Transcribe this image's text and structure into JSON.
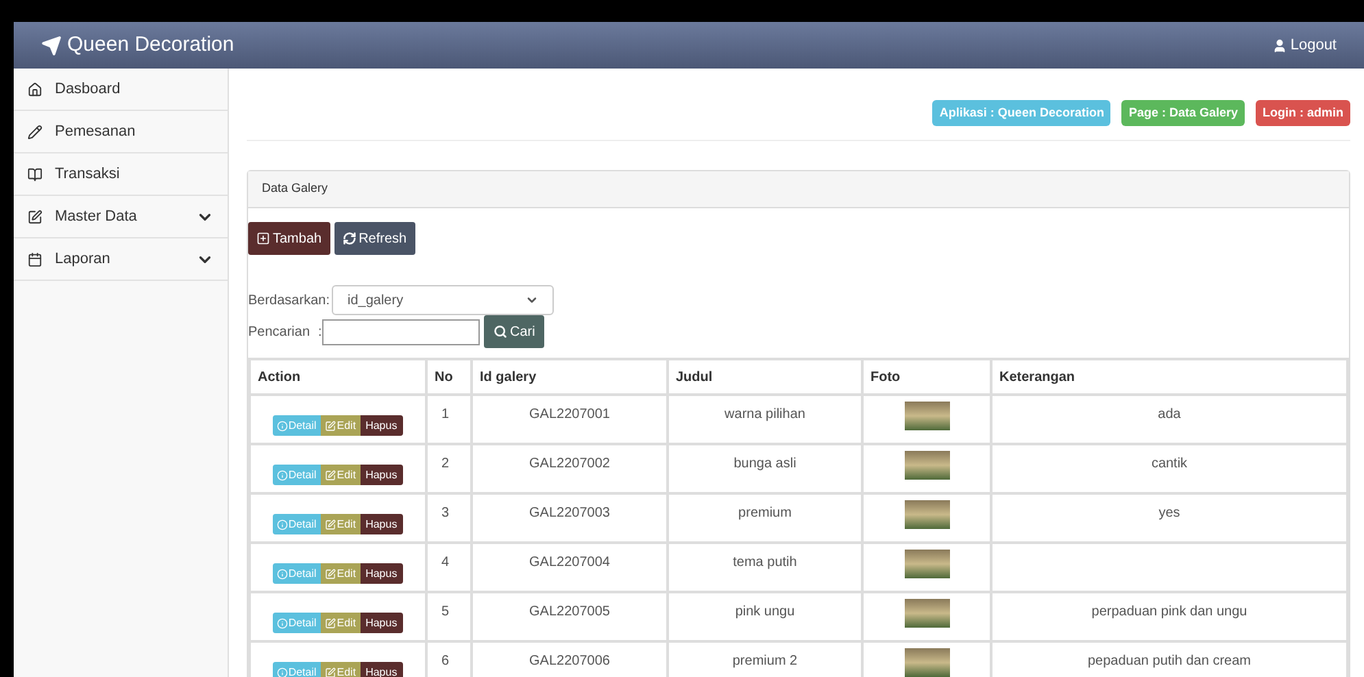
{
  "header": {
    "brand": "Queen Decoration",
    "logout": "Logout"
  },
  "sidebar": {
    "items": [
      {
        "label": "Dasboard",
        "kind": "home",
        "expandable": false
      },
      {
        "label": "Pemesanan",
        "kind": "pencil",
        "expandable": false
      },
      {
        "label": "Transaksi",
        "kind": "book",
        "expandable": false
      },
      {
        "label": "Master Data",
        "kind": "edit",
        "expandable": true
      },
      {
        "label": "Laporan",
        "kind": "calendar",
        "expandable": true
      }
    ]
  },
  "badges": [
    {
      "text": "Aplikasi : Queen Decoration",
      "color": "#5bc0de"
    },
    {
      "text": "Page : Data Galery",
      "color": "#5cb85c"
    },
    {
      "text": "Login : admin",
      "color": "#d9534f"
    }
  ],
  "panel": {
    "title": "Data Galery",
    "buttons": [
      "Tambah",
      "Refresh"
    ],
    "filter": {
      "label": "Berdasarkan:",
      "value": "id_galery"
    },
    "search": {
      "label": "Pencarian",
      "separator": ":",
      "button": "Cari"
    },
    "table": {
      "columns": [
        "Action",
        "No",
        "Id galery",
        "Judul",
        "Foto",
        "Keterangan"
      ],
      "rows": [
        {
          "actions": [
            "Detail",
            "Edit",
            "Hapus"
          ],
          "no": "1",
          "id": "GAL2207001",
          "judul": "warna pilihan",
          "keterangan": "ada"
        },
        {
          "actions": [
            "Detail",
            "Edit",
            "Hapus"
          ],
          "no": "2",
          "id": "GAL2207002",
          "judul": "bunga asli",
          "keterangan": "cantik"
        },
        {
          "actions": [
            "Detail",
            "Edit",
            "Hapus"
          ],
          "no": "3",
          "id": "GAL2207003",
          "judul": "premium",
          "keterangan": "yes"
        },
        {
          "actions": [
            "Detail",
            "Edit",
            "Hapus"
          ],
          "no": "4",
          "id": "GAL2207004",
          "judul": "tema putih",
          "keterangan": ""
        },
        {
          "actions": [
            "Detail",
            "Edit",
            "Hapus"
          ],
          "no": "5",
          "id": "GAL2207005",
          "judul": "pink ungu",
          "keterangan": "perpaduan pink dan ungu"
        },
        {
          "actions": [
            "Detail",
            "Edit",
            "Hapus"
          ],
          "no": "6",
          "id": "GAL2207006",
          "judul": "premium 2",
          "keterangan": "pepaduan putih dan cream"
        }
      ]
    }
  }
}
